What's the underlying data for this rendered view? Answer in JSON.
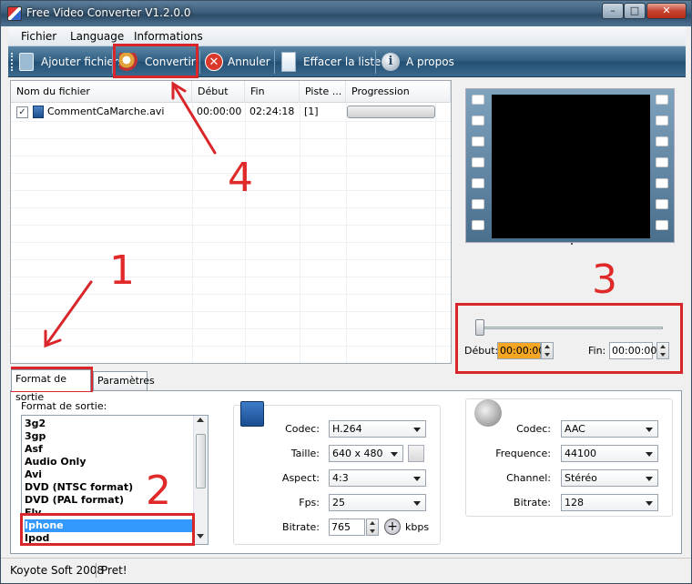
{
  "window": {
    "title": "Free Video Converter V1.2.0.0",
    "controls": {
      "minimize": "–",
      "maximize": "□",
      "close": "✕"
    }
  },
  "menu": [
    "Fichier",
    "Language",
    "Informations"
  ],
  "toolbar": {
    "add_files": "Ajouter fichiers",
    "convert": "Convertir",
    "cancel": "Annuler",
    "clear_list": "Effacer la liste",
    "about": "A propos",
    "cancel_glyph": "✕",
    "about_glyph": "i"
  },
  "file_list": {
    "columns": [
      "Nom du fichier",
      "Début",
      "Fin",
      "Piste ...",
      "Progression"
    ],
    "rows": [
      {
        "checked": "✓",
        "name": "CommentCaMarche.avi",
        "start": "00:00:00",
        "end": "02:24:18",
        "track": "[1]",
        "progress": 0
      }
    ]
  },
  "trim": {
    "start_label": "Début:",
    "start_value": "00:00:00",
    "end_label": "Fin:",
    "end_value": "00:00:00"
  },
  "tabs": [
    "Format de sortie",
    "Paramètres"
  ],
  "output_format": {
    "label": "Format de sortie:",
    "items": [
      "3g2",
      "3gp",
      "Asf",
      "Audio Only",
      "Avi",
      "DVD (NTSC format)",
      "DVD (PAL format)",
      "Flv",
      "Iphone",
      "Ipod"
    ],
    "selected": "Iphone"
  },
  "video": {
    "codec_label": "Codec:",
    "codec": "H.264",
    "size_label": "Taille:",
    "size": "640 x 480",
    "aspect_label": "Aspect:",
    "aspect": "4:3",
    "fps_label": "Fps:",
    "fps": "25",
    "bitrate_label": "Bitrate:",
    "bitrate": "765",
    "bitrate_unit": "kbps",
    "plus_glyph": "+"
  },
  "audio": {
    "codec_label": "Codec:",
    "codec": "AAC",
    "freq_label": "Frequence:",
    "freq": "44100",
    "channel_label": "Channel:",
    "channel": "Stéréo",
    "bitrate_label": "Bitrate:",
    "bitrate": "128"
  },
  "status": {
    "company": "Koyote Soft 2008",
    "state": "Pret!"
  },
  "annotations": {
    "n1": "1",
    "n2": "2",
    "n3": "3",
    "n4": "4",
    "color": "#d9262a"
  }
}
